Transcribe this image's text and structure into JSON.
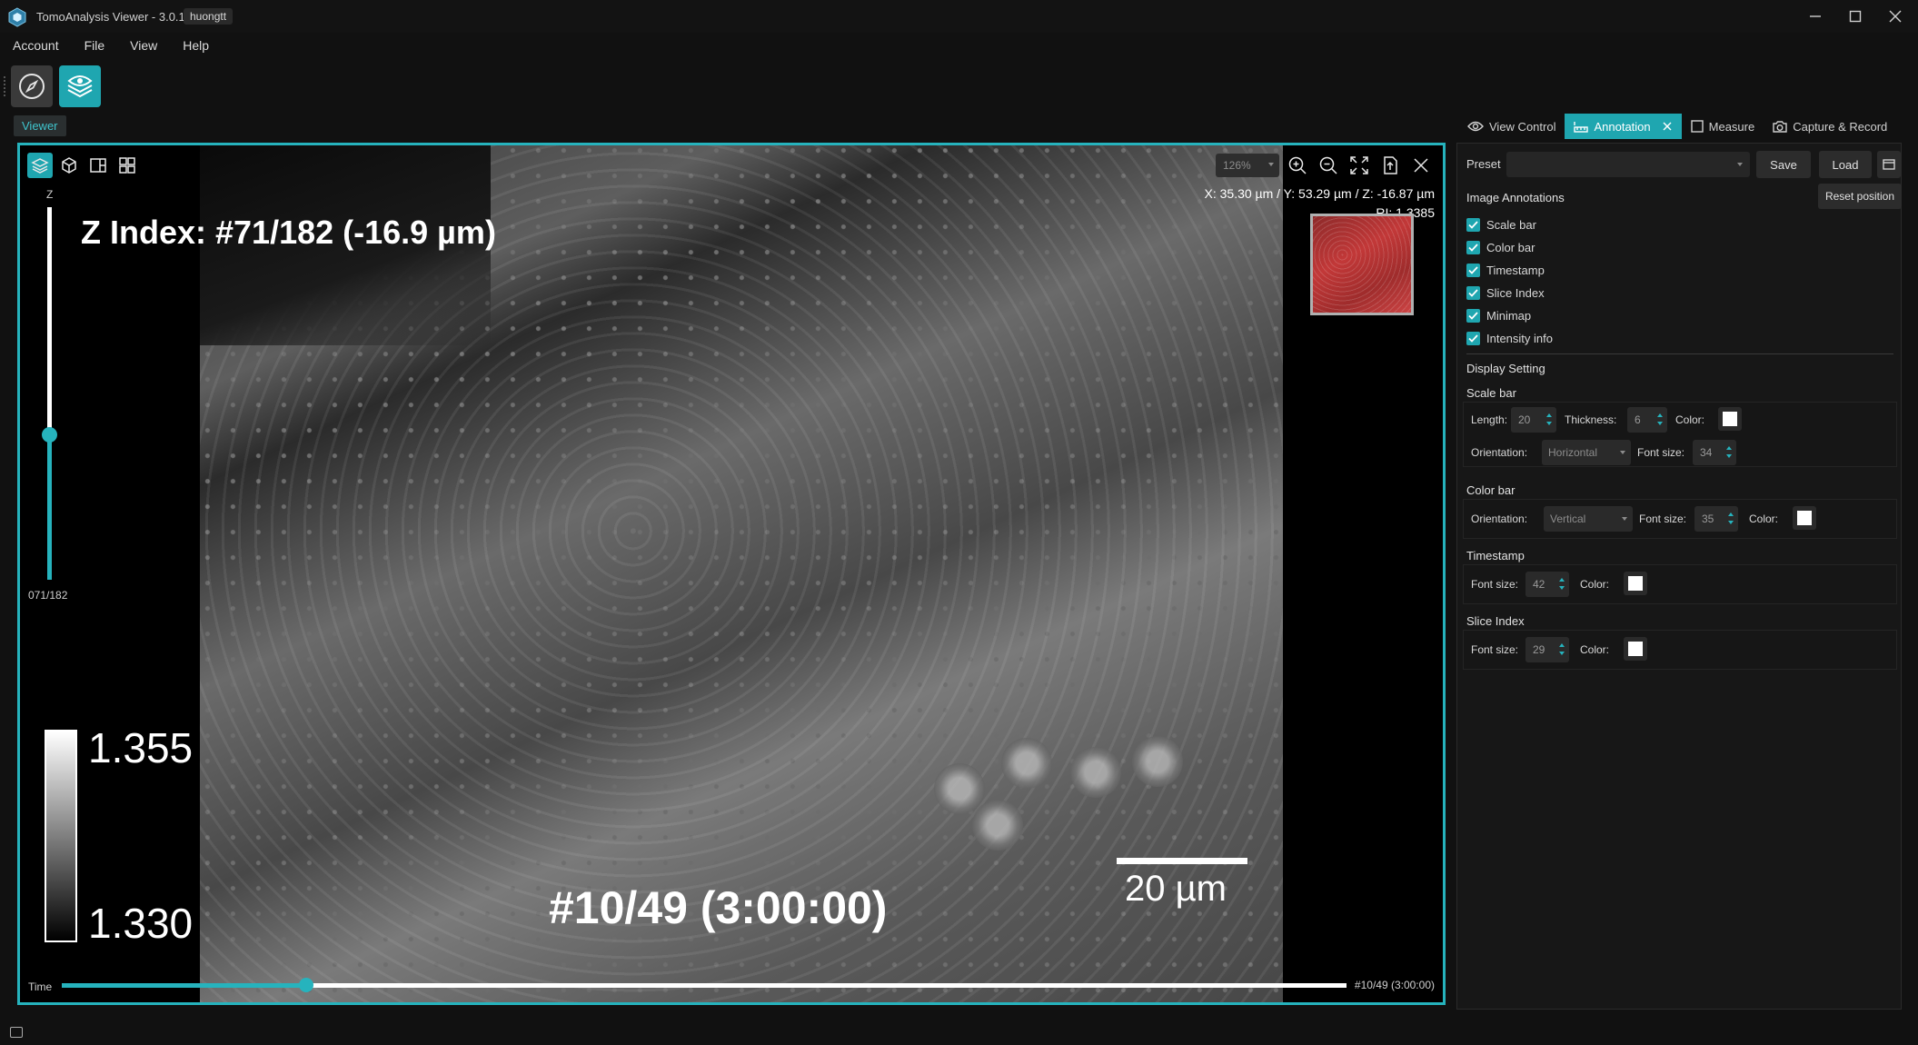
{
  "window": {
    "title": "TomoAnalysis Viewer - 3.0.17",
    "user": "huongtt"
  },
  "menu": [
    "Account",
    "File",
    "View",
    "Help"
  ],
  "viewer_tab": "Viewer",
  "viewport": {
    "z_axis_label": "Z",
    "z_value": "071/182",
    "z_level_fraction": 0.39,
    "z_index_text": "Z Index: #71/182 (-16.9 µm)",
    "zoom": "126%",
    "coordinates": "X: 35.30 µm / Y: 53.29 µm / Z: -16.87 µm",
    "ri": "RI: 1.3385",
    "colorbar_max": "1.355",
    "colorbar_min": "1.330",
    "timestamp_text": "#10/49 (3:00:00)",
    "scalebar_text": "20 µm",
    "time_label": "Time",
    "time_value": "#10/49 (3:00:00)",
    "time_fraction": 0.19
  },
  "panel_tabs": [
    {
      "label": "View Control",
      "icon": "eye-icon"
    },
    {
      "label": "Annotation",
      "icon": "ruler-icon",
      "active": true
    },
    {
      "label": "Measure",
      "icon": "square-icon"
    },
    {
      "label": "Capture & Record",
      "icon": "camera-icon"
    }
  ],
  "annotation": {
    "preset_label": "Preset",
    "preset_value": "",
    "save": "Save",
    "load": "Load",
    "image_annotations_heading": "Image Annotations",
    "reset_position": "Reset position",
    "checks": [
      {
        "label": "Scale bar",
        "checked": true
      },
      {
        "label": "Color bar",
        "checked": true
      },
      {
        "label": "Timestamp",
        "checked": true
      },
      {
        "label": "Slice Index",
        "checked": true
      },
      {
        "label": "Minimap",
        "checked": true
      },
      {
        "label": "Intensity info",
        "checked": true
      }
    ],
    "display_setting_heading": "Display Setting",
    "scale_bar": {
      "heading": "Scale bar",
      "length_label": "Length:",
      "length": "20",
      "thickness_label": "Thickness:",
      "thickness": "6",
      "color_label": "Color:",
      "orientation_label": "Orientation:",
      "orientation": "Horizontal",
      "font_size_label": "Font size:",
      "font_size": "34"
    },
    "color_bar": {
      "heading": "Color bar",
      "orientation_label": "Orientation:",
      "orientation": "Vertical",
      "font_size_label": "Font size:",
      "font_size": "35",
      "color_label": "Color:"
    },
    "timestamp": {
      "heading": "Timestamp",
      "font_size_label": "Font size:",
      "font_size": "42",
      "color_label": "Color:"
    },
    "slice_index": {
      "heading": "Slice Index",
      "font_size_label": "Font size:",
      "font_size": "29",
      "color_label": "Color:"
    }
  },
  "colors": {
    "accent": "#1fa6b0",
    "background": "#111111",
    "annotation_color": "#ffffff"
  }
}
